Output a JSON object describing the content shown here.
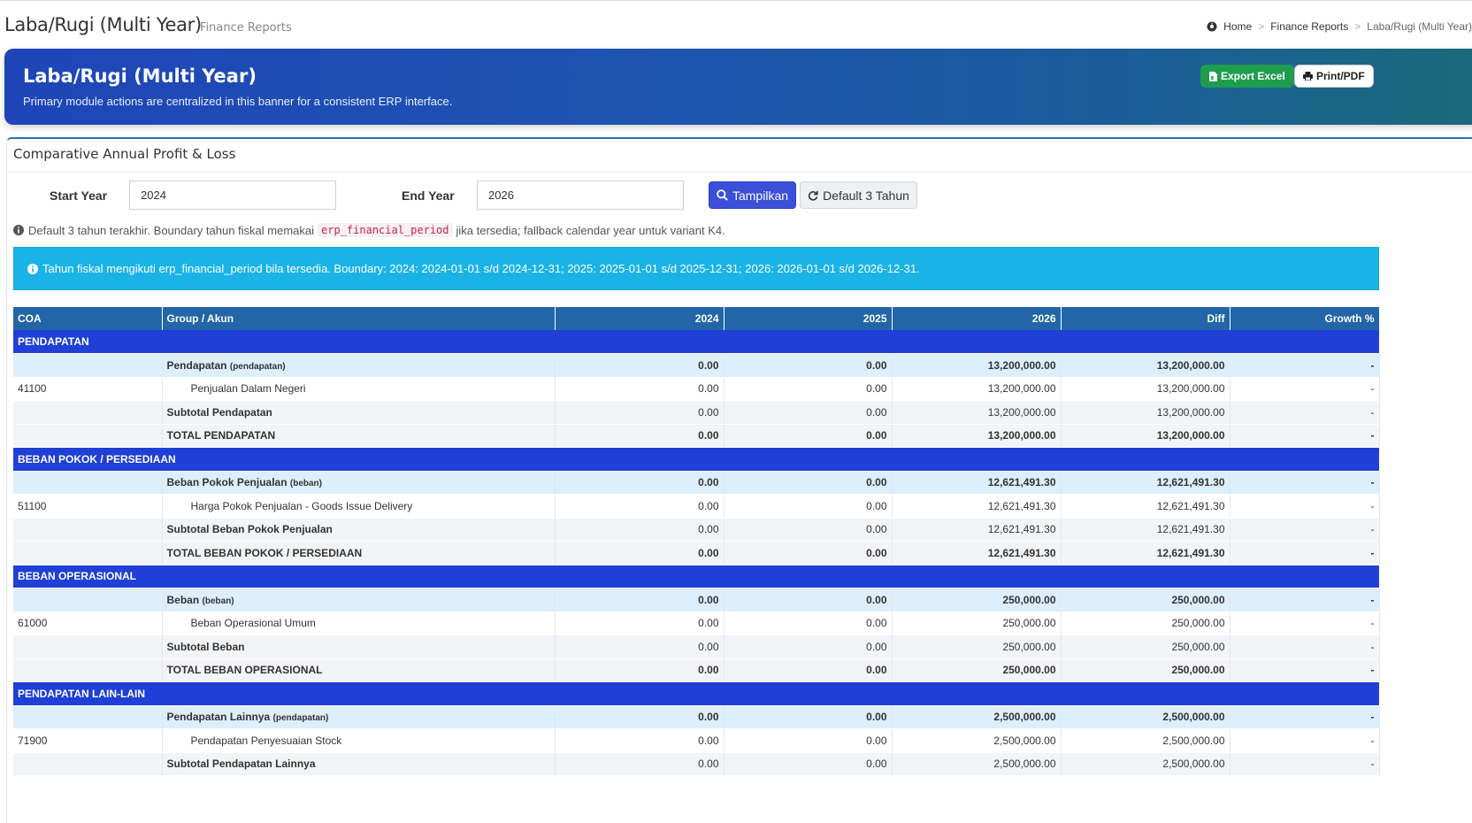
{
  "page": {
    "title": "Laba/Rugi (Multi Year)",
    "subtitle": "Finance Reports"
  },
  "breadcrumb": {
    "home": "Home",
    "parent": "Finance Reports",
    "current": "Laba/Rugi (Multi Year)"
  },
  "banner": {
    "title": "Laba/Rugi (Multi Year)",
    "description": "Primary module actions are centralized in this banner for a consistent ERP interface.",
    "export_label": "Export Excel",
    "print_label": "Print/PDF",
    "gradient_start": "#1f45b8",
    "gradient_end": "#1a6a7a",
    "export_color": "#1f9d4f"
  },
  "card": {
    "title": "Comparative Annual Profit & Loss"
  },
  "filters": {
    "start_label": "Start Year",
    "start_value": "2024",
    "end_label": "End Year",
    "end_value": "2026",
    "show_label": "Tampilkan",
    "default_label": "Default 3 Tahun"
  },
  "hint": {
    "before": "Default 3 tahun terakhir. Boundary tahun fiskal memakai",
    "code": "erp_financial_period",
    "after": "jika tersedia; fallback calendar year untuk variant K4."
  },
  "alert": {
    "text": "Tahun fiskal mengikuti erp_financial_period bila tersedia. Boundary: 2024: 2024-01-01 s/d 2024-12-31; 2025: 2025-01-01 s/d 2025-12-31; 2026: 2026-01-01 s/d 2026-12-31."
  },
  "table": {
    "columns": [
      "COA",
      "Group / Akun",
      "2024",
      "2025",
      "2026",
      "Diff",
      "Growth %"
    ],
    "rows": [
      {
        "type": "section",
        "coa": "PENDAPATAN"
      },
      {
        "type": "group",
        "coa": "",
        "name": "Pendapatan",
        "tag": "(pendapatan)",
        "v2024": "0.00",
        "v2025": "0.00",
        "v2026": "13,200,000.00",
        "diff": "13,200,000.00",
        "growth": "-"
      },
      {
        "type": "detail",
        "coa": "41100",
        "name": "Penjualan Dalam Negeri",
        "v2024": "0.00",
        "v2025": "0.00",
        "v2026": "13,200,000.00",
        "diff": "13,200,000.00",
        "growth": "-"
      },
      {
        "type": "subtotal",
        "coa": "",
        "name": "Subtotal Pendapatan",
        "v2024": "0.00",
        "v2025": "0.00",
        "v2026": "13,200,000.00",
        "diff": "13,200,000.00",
        "growth": "-"
      },
      {
        "type": "total",
        "coa": "",
        "name": "TOTAL PENDAPATAN",
        "v2024": "0.00",
        "v2025": "0.00",
        "v2026": "13,200,000.00",
        "diff": "13,200,000.00",
        "growth": "-"
      },
      {
        "type": "section",
        "coa": "BEBAN POKOK / PERSEDIAAN"
      },
      {
        "type": "group",
        "coa": "",
        "name": "Beban Pokok Penjualan",
        "tag": "(beban)",
        "v2024": "0.00",
        "v2025": "0.00",
        "v2026": "12,621,491.30",
        "diff": "12,621,491.30",
        "growth": "-"
      },
      {
        "type": "detail",
        "coa": "51100",
        "name": "Harga Pokok Penjualan - Goods Issue Delivery",
        "v2024": "0.00",
        "v2025": "0.00",
        "v2026": "12,621,491.30",
        "diff": "12,621,491.30",
        "growth": "-"
      },
      {
        "type": "subtotal",
        "coa": "",
        "name": "Subtotal Beban Pokok Penjualan",
        "v2024": "0.00",
        "v2025": "0.00",
        "v2026": "12,621,491.30",
        "diff": "12,621,491.30",
        "growth": "-"
      },
      {
        "type": "total",
        "coa": "",
        "name": "TOTAL BEBAN POKOK / PERSEDIAAN",
        "v2024": "0.00",
        "v2025": "0.00",
        "v2026": "12,621,491.30",
        "diff": "12,621,491.30",
        "growth": "-"
      },
      {
        "type": "section",
        "coa": "BEBAN OPERASIONAL"
      },
      {
        "type": "group",
        "coa": "",
        "name": "Beban",
        "tag": "(beban)",
        "v2024": "0.00",
        "v2025": "0.00",
        "v2026": "250,000.00",
        "diff": "250,000.00",
        "growth": "-"
      },
      {
        "type": "detail",
        "coa": "61000",
        "name": "Beban Operasional Umum",
        "v2024": "0.00",
        "v2025": "0.00",
        "v2026": "250,000.00",
        "diff": "250,000.00",
        "growth": "-"
      },
      {
        "type": "subtotal",
        "coa": "",
        "name": "Subtotal Beban",
        "v2024": "0.00",
        "v2025": "0.00",
        "v2026": "250,000.00",
        "diff": "250,000.00",
        "growth": "-"
      },
      {
        "type": "total",
        "coa": "",
        "name": "TOTAL BEBAN OPERASIONAL",
        "v2024": "0.00",
        "v2025": "0.00",
        "v2026": "250,000.00",
        "diff": "250,000.00",
        "growth": "-"
      },
      {
        "type": "section",
        "coa": "PENDAPATAN LAIN-LAIN"
      },
      {
        "type": "group",
        "coa": "",
        "name": "Pendapatan Lainnya",
        "tag": "(pendapatan)",
        "v2024": "0.00",
        "v2025": "0.00",
        "v2026": "2,500,000.00",
        "diff": "2,500,000.00",
        "growth": "-"
      },
      {
        "type": "detail",
        "coa": "71900",
        "name": "Pendapatan Penyesuaian Stock",
        "v2024": "0.00",
        "v2025": "0.00",
        "v2026": "2,500,000.00",
        "diff": "2,500,000.00",
        "growth": "-"
      },
      {
        "type": "subtotal",
        "coa": "",
        "name": "Subtotal Pendapatan Lainnya",
        "v2024": "0.00",
        "v2025": "0.00",
        "v2026": "2,500,000.00",
        "diff": "2,500,000.00",
        "growth": "-"
      }
    ]
  }
}
